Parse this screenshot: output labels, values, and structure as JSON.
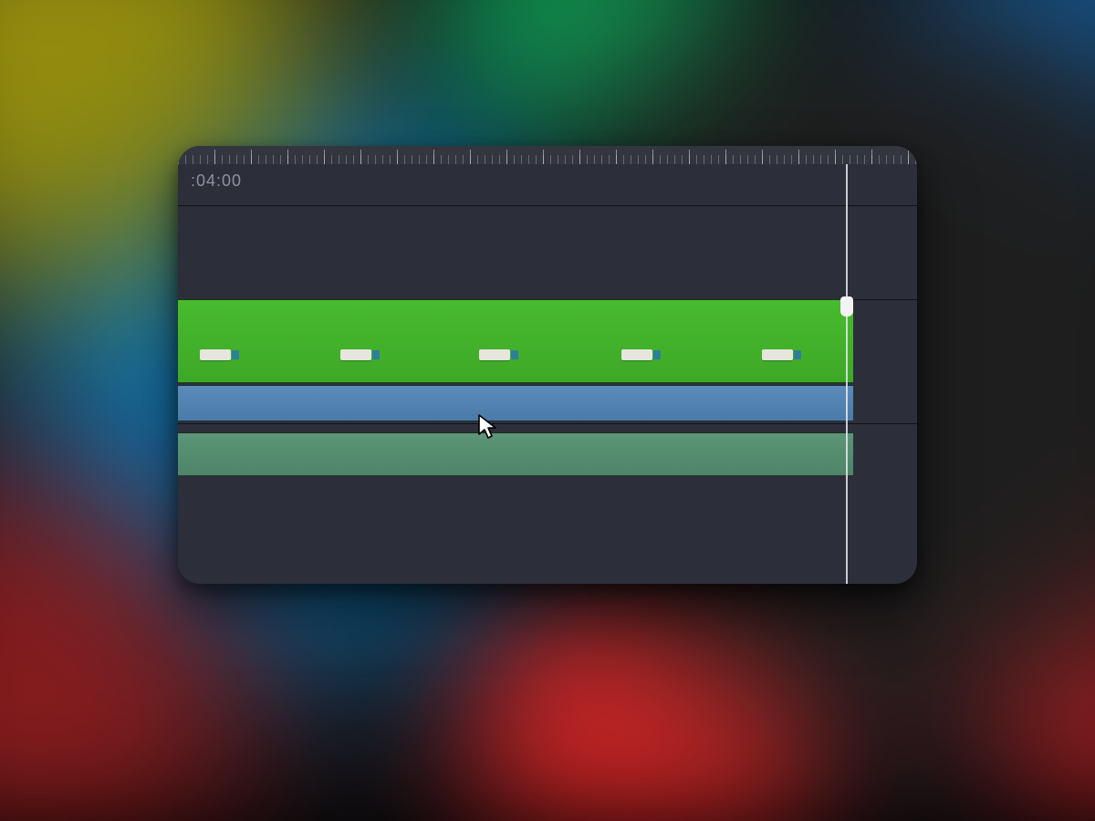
{
  "timeline": {
    "timecode_label": ":04:00",
    "tracks": {
      "video": {
        "markers": [
          {
            "label": ""
          },
          {
            "label": ""
          },
          {
            "label": ""
          },
          {
            "label": ""
          },
          {
            "label": ""
          }
        ]
      }
    }
  }
}
